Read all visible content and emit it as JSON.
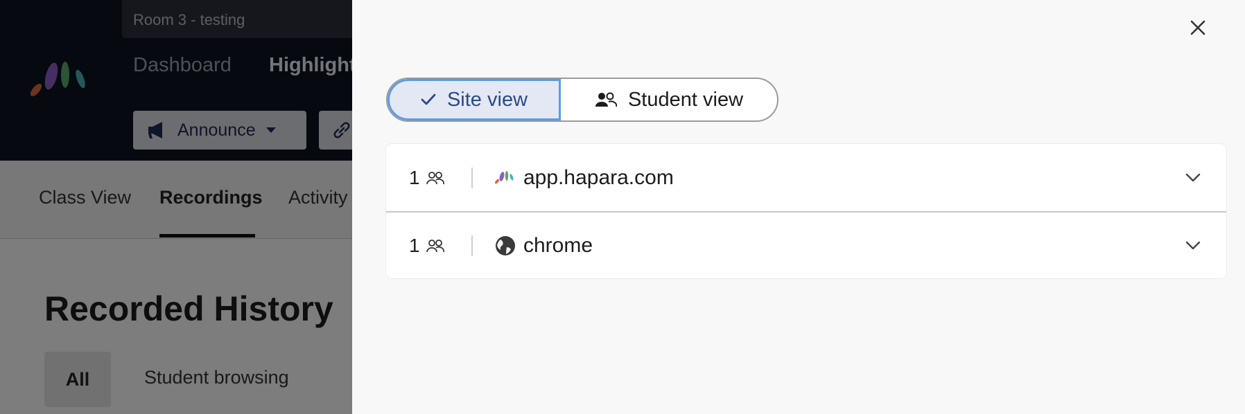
{
  "app": {
    "room_name": "Room 3 - testing",
    "nav": [
      "Dashboard",
      "Highlight"
    ],
    "announce_label": "Announce",
    "subtabs": [
      "Class View",
      "Recordings",
      "Activity"
    ],
    "page_title": "Recorded History",
    "filters": {
      "all": "All",
      "browsing": "Student browsing"
    }
  },
  "drawer": {
    "toggle": {
      "site_view": "Site view",
      "student_view": "Student view",
      "selected": "Site view"
    },
    "sites": [
      {
        "count": "1",
        "name": "app.hapara.com",
        "icon": "hapara-logo-icon"
      },
      {
        "count": "1",
        "name": "chrome",
        "icon": "globe-icon"
      }
    ]
  },
  "colors": {
    "accent": "#5b9be6",
    "dark_header": "#0d1321",
    "selected_toggle_bg": "#e4e8f4"
  }
}
